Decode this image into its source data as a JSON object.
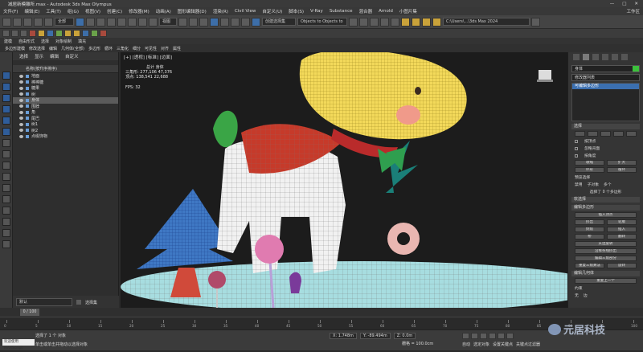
{
  "window": {
    "title": "减居新模雕所.max - Autodesk 3ds Max Olympus",
    "buttons": [
      "—",
      "□",
      "✕"
    ]
  },
  "menu": [
    "文件(F)",
    "编辑(E)",
    "工具(T)",
    "组(G)",
    "视图(V)",
    "创建(C)",
    "修改器(M)",
    "动画(A)",
    "图形编辑器(D)",
    "渲染(R)",
    "Civil View",
    "自定义(U)",
    "脚本(S)",
    "V-Ray",
    "Substance",
    "混合器",
    "Arnold",
    "小图片集",
    "工作区"
  ],
  "toolbar": {
    "selection_filter": "全部",
    "named_selection": "创建选择集",
    "viewport_dd": "视图",
    "search_placeholder": "Objects to Objects to",
    "path": "C:\\Users\\...\\3ds Max 2024"
  },
  "ribbon_tabs": [
    "建模",
    "自由形式",
    "选择",
    "对象绘制",
    "填充"
  ],
  "ribbon_row": [
    "多边形建模",
    "修改选择",
    "编辑",
    "几何体(全部)",
    "多边形",
    "循环",
    "三角化",
    "细分",
    "可见性",
    "对齐",
    "属性"
  ],
  "scene_explorer": {
    "tabs": [
      "选择",
      "显示",
      "编辑",
      "自定义"
    ],
    "header": "名称(按升序排序)",
    "items": [
      {
        "name": "地面"
      },
      {
        "name": "棒棒糖"
      },
      {
        "name": "糖果"
      },
      {
        "name": "树"
      },
      {
        "name": "身体",
        "selected": true
      },
      {
        "name": "围脖"
      },
      {
        "name": "角"
      },
      {
        "name": "尾巴"
      },
      {
        "name": "树1"
      },
      {
        "name": "树2"
      },
      {
        "name": "点缀饰物"
      }
    ],
    "layer_label": "默认",
    "layer_dd": "选择集"
  },
  "viewport": {
    "label": "[+] [透视] [标准] [边面]",
    "stats": {
      "header": "总计 身体",
      "polys_label": "三角形:",
      "polys_total": "277,106",
      "polys_sel": "47,376",
      "verts_label": "顶点:",
      "verts_total": "138,541",
      "verts_sel": "22,688",
      "fps_label": "FPS:",
      "fps": "32"
    }
  },
  "command_panel": {
    "object_name": "身体",
    "modifier_list": "修改器列表",
    "stack_item": "可编辑多边形",
    "selection_rollout": "选择",
    "selection_buttons": [
      "按顶点",
      "忽略背面",
      "按角度",
      "收缩",
      "扩大",
      "环形",
      "循环"
    ],
    "preview_label": "预览选择",
    "preview_options": [
      "禁用",
      "子对象",
      "多个"
    ],
    "selected_text": "选择了 0 个多边形",
    "soft_sel": "软选择",
    "edit_poly_rollout": "编辑多边形",
    "edit_buttons": [
      "插入顶点",
      "挤出",
      "轮廓",
      "倒角",
      "插入",
      "桥",
      "翻转",
      "从边旋转",
      "沿样条线挤出",
      "编辑三角剖分",
      "重复三角算法",
      "旋转"
    ],
    "edit_geom_rollout": "编辑几何体",
    "repeat_last": "重复上一个",
    "constraint_label": "约束",
    "constraint_options": [
      "无",
      "边"
    ]
  },
  "time_slider": {
    "value": "0 / 100"
  },
  "timeline_ticks": [
    "0",
    "5",
    "10",
    "15",
    "20",
    "25",
    "30",
    "35",
    "40",
    "45",
    "50",
    "55",
    "60",
    "65",
    "70",
    "75",
    "80",
    "85",
    "90",
    "95",
    "100"
  ],
  "status": {
    "maxscript": "欢迎使用MAXScript",
    "line1": "选择了 1 个 对象",
    "line2": "单击或单击并拖动以选择对象",
    "x": "X: 1.748m",
    "y": "Y: -89.494m",
    "z": "Z: 0.0m",
    "grid": "栅格 = 100.0cm",
    "autokey": "自动",
    "selected": "选定对象",
    "setkey": "设置关键点",
    "keyfilter": "关键点过滤器"
  },
  "watermark": "元居科技"
}
